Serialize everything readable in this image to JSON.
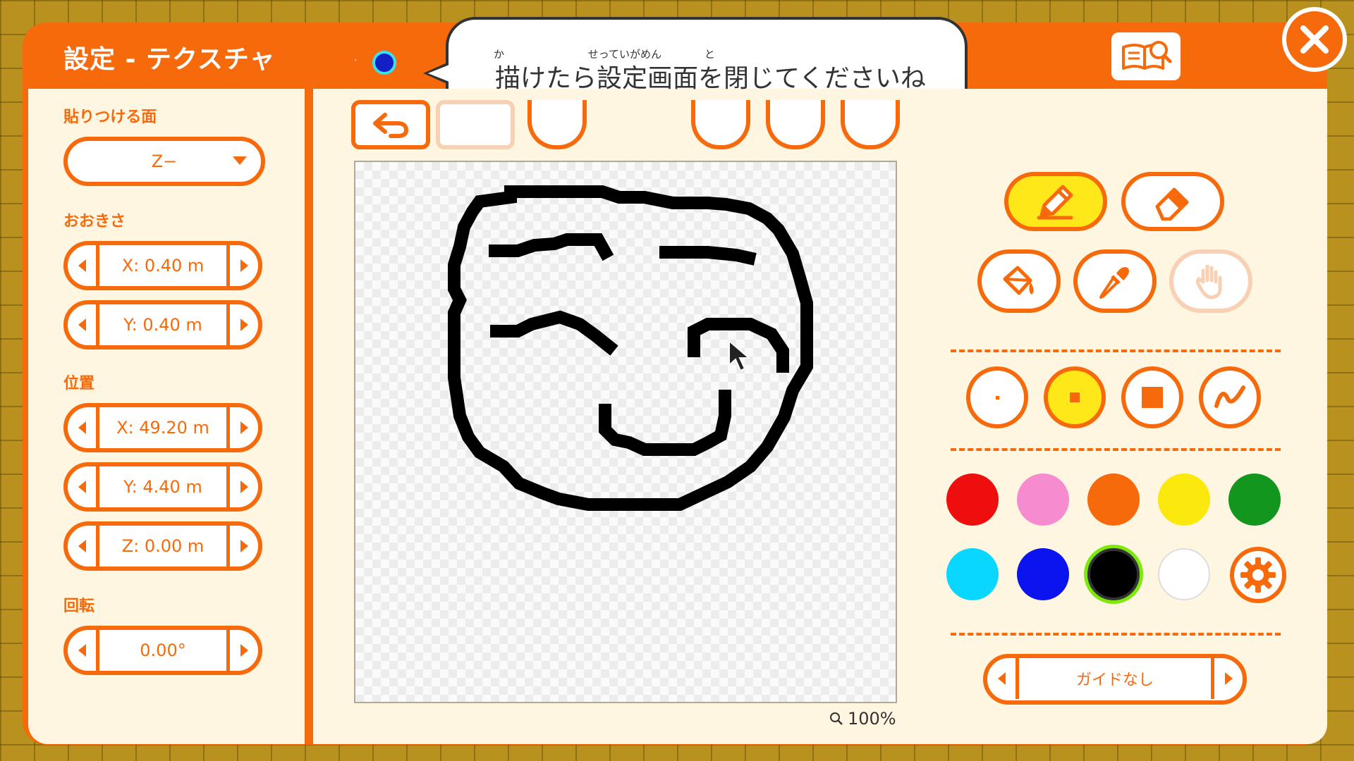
{
  "header": {
    "title": "設定 - テクスチャ"
  },
  "speech": {
    "ruby": [
      "か",
      "せっていがめん",
      "と"
    ],
    "text": "描けたら設定画面を閉じてくださいね"
  },
  "icons": {
    "guide": "guidebook-search-icon",
    "close": "close-x-icon",
    "undo": "undo-arrow-icon",
    "pencil": "pencil-icon",
    "eraser": "eraser-icon",
    "bucket": "paint-bucket-icon",
    "eyedropper": "eyedropper-icon",
    "hand": "hand-icon",
    "gear": "gear-icon"
  },
  "left": {
    "face_label": "貼りつける面",
    "face_value": "Z−",
    "size_label": "おおきさ",
    "size_x": "X: 0.40 m",
    "size_y": "Y: 0.40 m",
    "pos_label": "位置",
    "pos_x": "X: 49.20 m",
    "pos_y": "Y: 4.40 m",
    "pos_z": "Z: 0.00 m",
    "rot_label": "回転",
    "rot_value": "0.00°"
  },
  "canvas": {
    "zoom": "100%"
  },
  "palette": {
    "colors": [
      "#ee0e0e",
      "#f78bd0",
      "#f76a0c",
      "#fbe90d",
      "#12961e",
      "#0ad7ff",
      "#0b14ee",
      "#000000",
      "#ffffff"
    ],
    "selected_index": 7
  },
  "tools": {
    "active": "pencil",
    "brush_active": "small"
  },
  "guide_option": "ガイドなし",
  "colors": {
    "accent": "#f76a0c",
    "highlight": "#ffe81a"
  }
}
